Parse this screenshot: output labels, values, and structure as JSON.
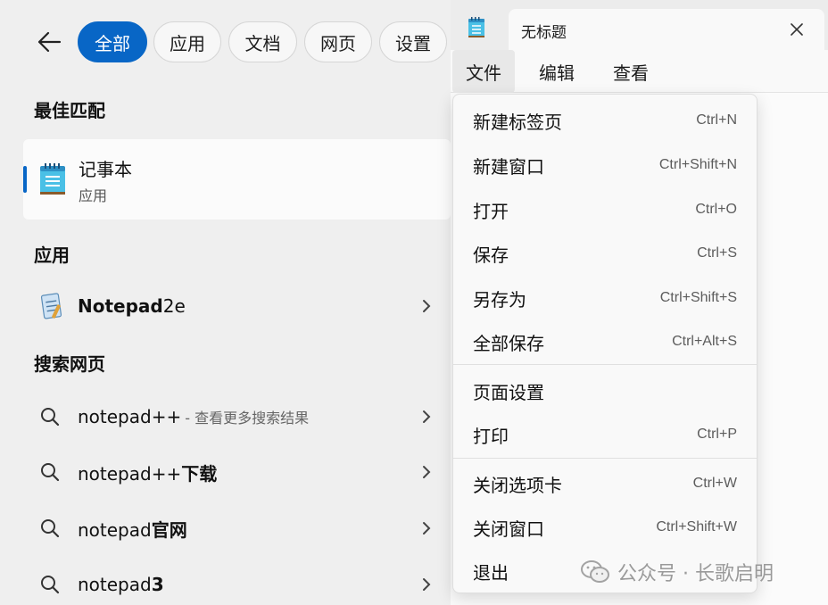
{
  "search": {
    "filters": [
      "全部",
      "应用",
      "文档",
      "网页",
      "设置"
    ],
    "best_match_heading": "最佳匹配",
    "best_match": {
      "title": "记事本",
      "subtitle": "应用"
    },
    "apps_heading": "应用",
    "app_result": {
      "bold": "Notepad",
      "rest": "2e"
    },
    "web_heading": "搜索网页",
    "web_results": [
      {
        "normal": "notepad++",
        "bold": "",
        "hint": "- 查看更多搜索结果"
      },
      {
        "normal": "notepad++",
        "bold": "下载",
        "hint": ""
      },
      {
        "normal": "notepad",
        "bold": "官网",
        "hint": ""
      },
      {
        "normal": "notepad",
        "bold": "3",
        "hint": ""
      }
    ]
  },
  "notepad": {
    "tab_title": "无标题",
    "menus": [
      "文件",
      "编辑",
      "查看"
    ],
    "file_menu": [
      {
        "label": "新建标签页",
        "shortcut": "Ctrl+N"
      },
      {
        "label": "新建窗口",
        "shortcut": "Ctrl+Shift+N"
      },
      {
        "label": "打开",
        "shortcut": "Ctrl+O"
      },
      {
        "label": "保存",
        "shortcut": "Ctrl+S"
      },
      {
        "label": "另存为",
        "shortcut": "Ctrl+Shift+S"
      },
      {
        "label": "全部保存",
        "shortcut": "Ctrl+Alt+S"
      },
      {
        "label": "页面设置",
        "shortcut": ""
      },
      {
        "label": "打印",
        "shortcut": "Ctrl+P"
      },
      {
        "label": "关闭选项卡",
        "shortcut": "Ctrl+W"
      },
      {
        "label": "关闭窗口",
        "shortcut": "Ctrl+Shift+W"
      },
      {
        "label": "退出",
        "shortcut": ""
      }
    ]
  },
  "watermark": {
    "text": "公众号 · 长歌启明"
  },
  "colors": {
    "accent": "#0866c6",
    "panel": "#efefef",
    "menu_bg": "#f9f9f9"
  },
  "icons": {
    "back": "arrow-left-icon",
    "notepad": "notepad-icon",
    "notepad2e": "notepad2e-icon",
    "search": "search-icon",
    "chevron": "chevron-right-icon",
    "close": "close-icon",
    "wechat": "wechat-icon"
  }
}
